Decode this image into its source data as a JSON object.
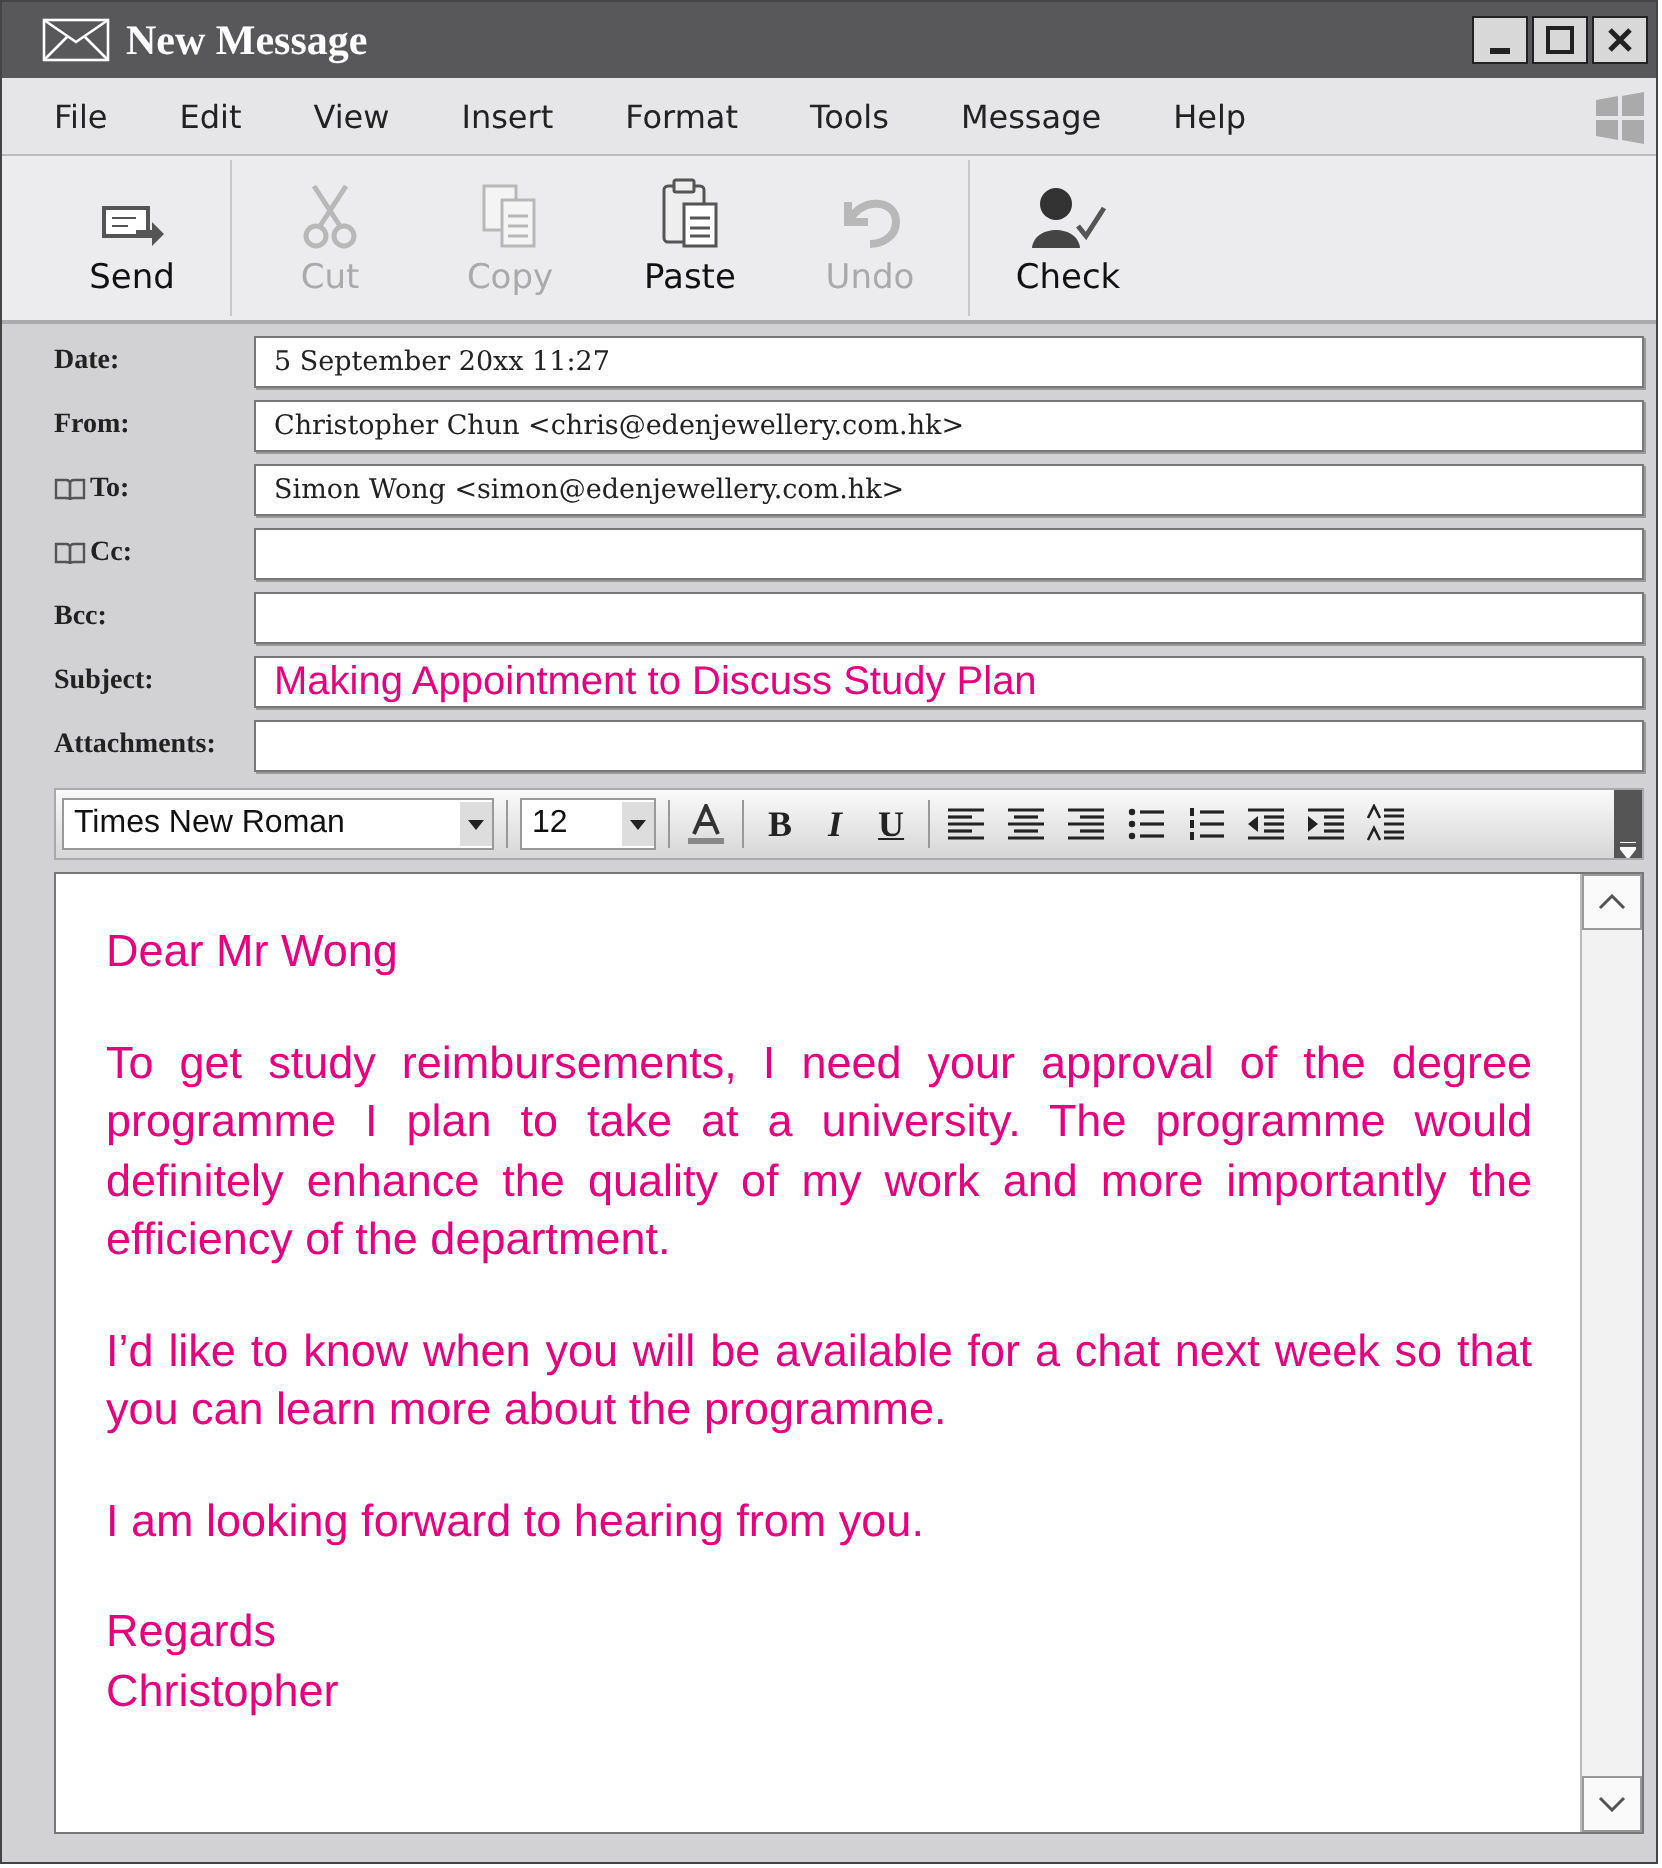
{
  "window": {
    "title": "New Message"
  },
  "menu": [
    "File",
    "Edit",
    "View",
    "Insert",
    "Format",
    "Tools",
    "Message",
    "Help"
  ],
  "toolbar": [
    {
      "label": "Send",
      "kind": "send",
      "disabled": false
    },
    {
      "label": "Cut",
      "kind": "cut",
      "disabled": true
    },
    {
      "label": "Copy",
      "kind": "copy",
      "disabled": true
    },
    {
      "label": "Paste",
      "kind": "paste",
      "disabled": false
    },
    {
      "label": "Undo",
      "kind": "undo",
      "disabled": true
    },
    {
      "label": "Check",
      "kind": "check",
      "disabled": false
    }
  ],
  "fields": [
    {
      "label": "Date:",
      "value": "5 September 20xx 11:27",
      "address_book": false,
      "kind": "plain"
    },
    {
      "label": "From:",
      "value": "Christopher Chun <chris@edenjewellery.com.hk>",
      "address_book": false,
      "kind": "plain"
    },
    {
      "label": "To:",
      "value": "Simon Wong <simon@edenjewellery.com.hk>",
      "address_book": true,
      "kind": "plain"
    },
    {
      "label": "Cc:",
      "address_book": true,
      "kind": "plain"
    },
    {
      "label": "Bcc:",
      "address_book": false,
      "kind": "plain"
    },
    {
      "label": "Subject:",
      "value": "Making Appointment to Discuss Study Plan",
      "address_book": false,
      "kind": "subject"
    },
    {
      "label": "Attachments:",
      "address_book": false,
      "kind": "plain"
    }
  ],
  "format_bar": {
    "font": "Times New Roman",
    "size": "12",
    "buttons": [
      {
        "kind": "color"
      },
      {
        "kind": "text",
        "label": "B"
      },
      {
        "kind": "text",
        "label": "I"
      },
      {
        "kind": "text",
        "label": "U"
      },
      {
        "kind": "align-left"
      },
      {
        "kind": "align-center"
      },
      {
        "kind": "align-right"
      },
      {
        "kind": "bullets"
      },
      {
        "kind": "numbering"
      },
      {
        "kind": "outdent"
      },
      {
        "kind": "indent"
      },
      {
        "kind": "spacing"
      }
    ]
  },
  "body": [
    "Dear Mr Wong",
    "To get study reimbursements, I need your approval of the degree programme I plan to take at a university. The programme would definitely enhance the quality of my work and more importantly the efficiency of the department.",
    "I’d like to know when you will be available for a chat next week so that you can learn more about the programme.",
    "I am looking forward to hearing from you.",
    "Regards\nChristopher"
  ]
}
